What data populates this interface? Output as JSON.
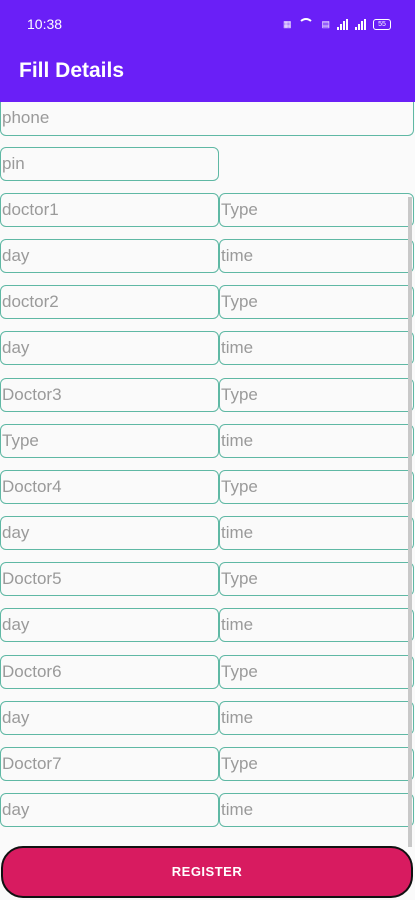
{
  "status_bar": {
    "time": "10:38",
    "battery": "55",
    "icons": [
      "nfc-icon",
      "wifi-icon",
      "signal-icon",
      "signal-icon",
      "battery-icon"
    ]
  },
  "app_bar": {
    "title": "Fill Details"
  },
  "form": {
    "phone": "phone",
    "pin": "pin",
    "rows": [
      {
        "left": "doctor1",
        "right": "Type"
      },
      {
        "left": "day",
        "right": "time"
      },
      {
        "left": "doctor2",
        "right": "Type"
      },
      {
        "left": "day",
        "right": "time"
      },
      {
        "left": "Doctor3",
        "right": "Type"
      },
      {
        "left": "Type",
        "right": "time"
      },
      {
        "left": "Doctor4",
        "right": "Type"
      },
      {
        "left": "day",
        "right": "time"
      },
      {
        "left": "Doctor5",
        "right": "Type"
      },
      {
        "left": "day",
        "right": "time"
      },
      {
        "left": "Doctor6",
        "right": "Type"
      },
      {
        "left": "day",
        "right": "time"
      },
      {
        "left": "Doctor7",
        "right": "Type"
      },
      {
        "left": "day",
        "right": "time"
      }
    ]
  },
  "register_label": "REGISTER",
  "colors": {
    "app_bar": "#6a1ff7",
    "field_border": "#5fb8a4",
    "button": "#d81b60",
    "placeholder": "#9a9a9a"
  }
}
